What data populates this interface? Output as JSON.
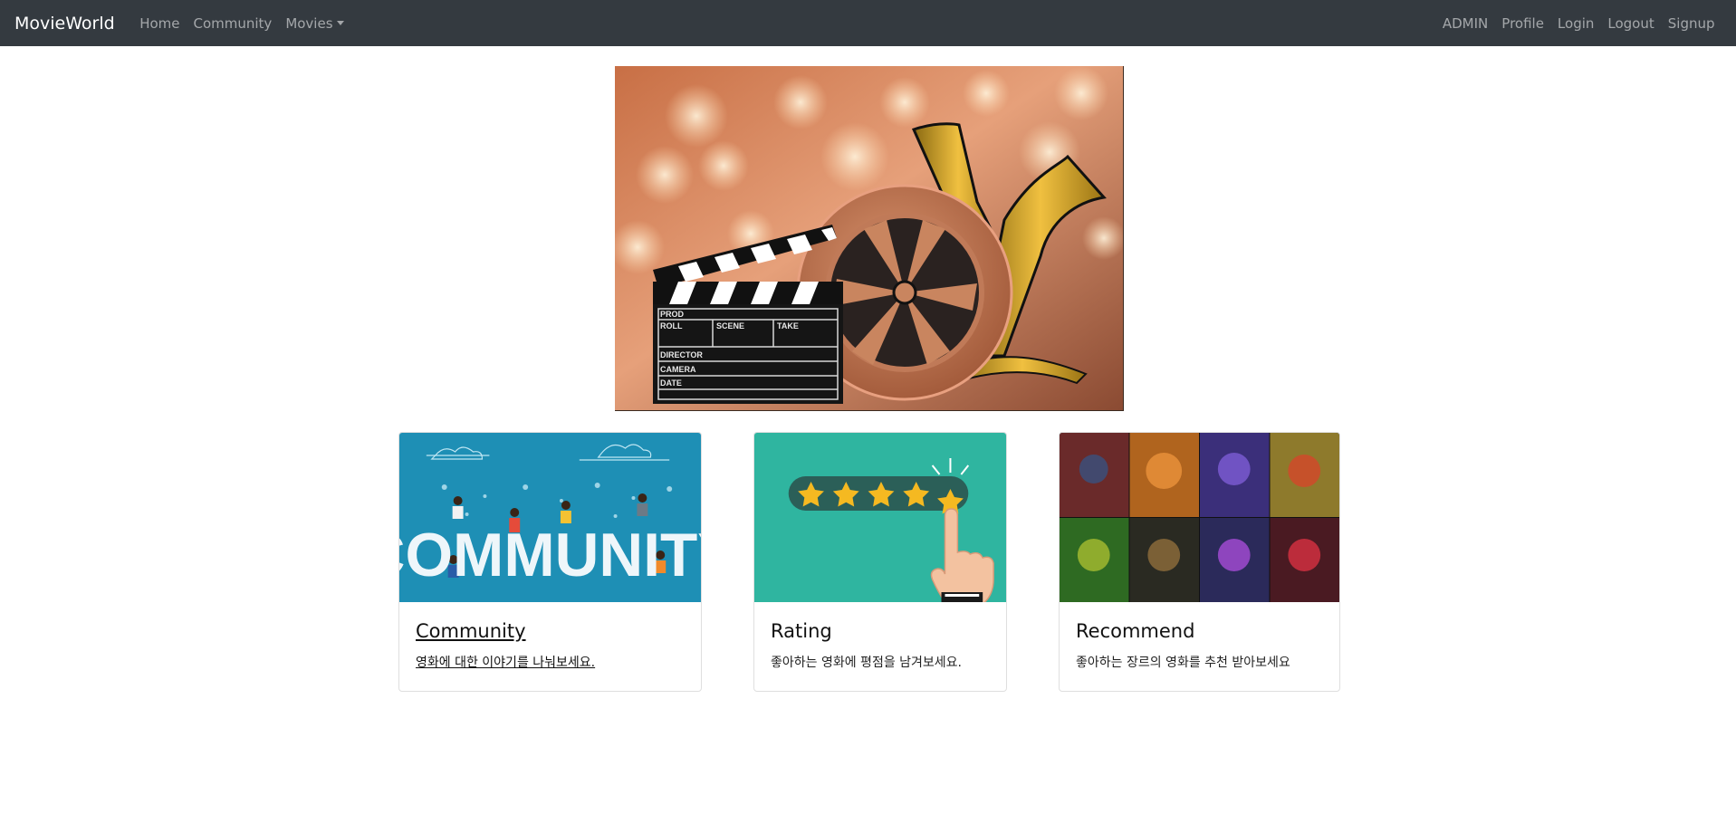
{
  "navbar": {
    "brand": "MovieWorld",
    "left": [
      {
        "label": "Home"
      },
      {
        "label": "Community"
      },
      {
        "label": "Movies"
      }
    ],
    "right": [
      {
        "label": "ADMIN"
      },
      {
        "label": "Profile"
      },
      {
        "label": "Login"
      },
      {
        "label": "Logout"
      },
      {
        "label": "Signup"
      }
    ]
  },
  "hero": {
    "slate": {
      "prod": "PROD",
      "roll": "ROLL",
      "scene": "SCENE",
      "take": "TAKE",
      "director": "DIRECTOR",
      "camera": "CAMERA",
      "date": "DATE"
    }
  },
  "cards": [
    {
      "image_text": "COMMUNITY",
      "title": "Community",
      "text": "영화에 대한 이야기를 나눠보세요."
    },
    {
      "title": "Rating",
      "text": "좋아하는 영화에 평점을 남겨보세요.",
      "stars": 5
    },
    {
      "title": "Recommend",
      "text": "좋아하는 장르의 영화를 추천 받아보세요"
    }
  ],
  "colors": {
    "navbar_bg": "#343a40",
    "community_bg": "#1e8fb5",
    "rating_bg": "#2fb5a0",
    "star": "#f5b921"
  }
}
